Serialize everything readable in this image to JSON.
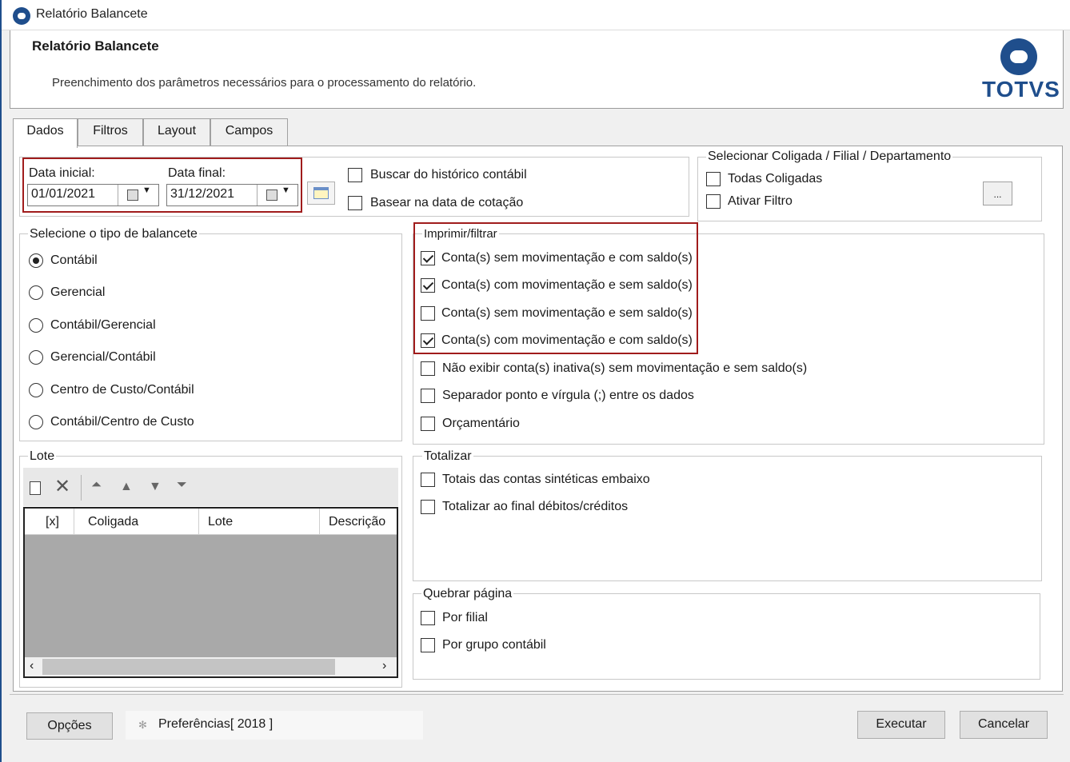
{
  "window": {
    "title": "Relatório Balancete"
  },
  "header": {
    "title": "Relatório Balancete",
    "description": "Preenchimento dos parâmetros necessários para o processamento do relatório.",
    "logo_text": "TOTVS"
  },
  "tabs": [
    {
      "label": "Dados",
      "active": true
    },
    {
      "label": "Filtros",
      "active": false
    },
    {
      "label": "Layout",
      "active": false
    },
    {
      "label": "Campos",
      "active": false
    }
  ],
  "dates": {
    "start_label": "Data inicial:",
    "start_value": "01/01/2021",
    "end_label": "Data final:",
    "end_value": "31/12/2021"
  },
  "options_top": {
    "buscar_historico": {
      "label": "Buscar do histórico contábil",
      "checked": false
    },
    "basear_cotacao": {
      "label": "Basear na data de cotação",
      "checked": false
    }
  },
  "coligada": {
    "title": "Selecionar Coligada / Filial / Departamento",
    "todas": {
      "label": "Todas Coligadas",
      "checked": false
    },
    "ativar": {
      "label": "Ativar Filtro",
      "checked": false
    },
    "ellipsis_label": "..."
  },
  "tipo_balancete": {
    "title": "Selecione o tipo de balancete",
    "options": [
      {
        "label": "Contábil",
        "checked": true
      },
      {
        "label": "Gerencial",
        "checked": false
      },
      {
        "label": "Contábil/Gerencial",
        "checked": false
      },
      {
        "label": "Gerencial/Contábil",
        "checked": false
      },
      {
        "label": "Centro de Custo/Contábil",
        "checked": false
      },
      {
        "label": "Contábil/Centro de Custo",
        "checked": false
      }
    ]
  },
  "imprimir": {
    "title": "Imprimir/filtrar",
    "options": [
      {
        "label": "Conta(s) sem movimentação e com saldo(s)",
        "checked": true
      },
      {
        "label": "Conta(s) com movimentação e sem saldo(s)",
        "checked": true
      },
      {
        "label": "Conta(s) sem movimentação e sem saldo(s)",
        "checked": false
      },
      {
        "label": "Conta(s) com movimentação e com saldo(s)",
        "checked": true
      },
      {
        "label": "Não exibir conta(s) inativa(s) sem movimentação e sem saldo(s)",
        "checked": false
      },
      {
        "label": "Separador ponto e vírgula (;) entre os dados",
        "checked": false
      },
      {
        "label": "Orçamentário",
        "checked": false
      }
    ]
  },
  "lote": {
    "title": "Lote",
    "columns": [
      "[x]",
      "Coligada",
      "Lote",
      "Descrição"
    ],
    "toolbar_icons": [
      "new-icon",
      "delete-icon",
      "move-top-icon",
      "move-up-icon",
      "move-down-icon",
      "move-bottom-icon"
    ]
  },
  "totalizar": {
    "title": "Totalizar",
    "options": [
      {
        "label": "Totais das contas sintéticas embaixo",
        "checked": false
      },
      {
        "label": "Totalizar ao final débitos/créditos",
        "checked": false
      }
    ]
  },
  "quebrar": {
    "title": "Quebrar página",
    "options": [
      {
        "label": "Por filial",
        "checked": false
      },
      {
        "label": "Por grupo contábil",
        "checked": false
      }
    ]
  },
  "footer": {
    "opcoes_label": "Opções",
    "preferencias_label": "Preferências[ 2018 ]",
    "executar_label": "Executar",
    "cancelar_label": "Cancelar"
  }
}
